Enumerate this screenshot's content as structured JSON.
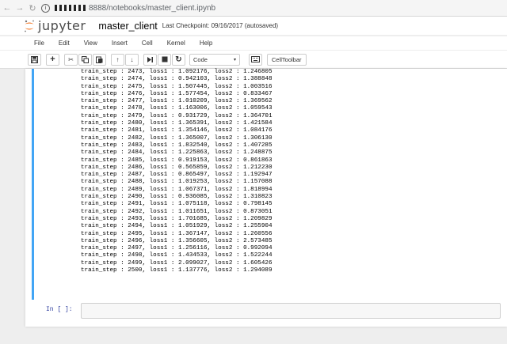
{
  "browser": {
    "url": "8888/notebooks/master_client.ipynb"
  },
  "header": {
    "logo_text": "jupyter",
    "notebook_name": "master_client",
    "checkpoint": "Last Checkpoint: 09/16/2017 (autosaved)"
  },
  "menu": [
    "File",
    "Edit",
    "View",
    "Insert",
    "Cell",
    "Kernel",
    "Help"
  ],
  "toolbar": {
    "cell_type": "Code",
    "celltoolbar_label": "CellToolbar"
  },
  "output_lines": [
    "train_step : 2473, loss1 : 1.092176, loss2 : 1.246805",
    "train_step : 2474, loss1 : 0.942103, loss2 : 1.388848",
    "train_step : 2475, loss1 : 1.507445, loss2 : 1.003516",
    "train_step : 2476, loss1 : 1.577454, loss2 : 0.833467",
    "train_step : 2477, loss1 : 1.010209, loss2 : 1.369562",
    "train_step : 2478, loss1 : 1.163006, loss2 : 1.059543",
    "train_step : 2479, loss1 : 0.931729, loss2 : 1.364701",
    "train_step : 2480, loss1 : 1.365391, loss2 : 1.421584",
    "train_step : 2481, loss1 : 1.354146, loss2 : 1.084176",
    "train_step : 2482, loss1 : 1.365007, loss2 : 1.306130",
    "train_step : 2483, loss1 : 1.832540, loss2 : 1.407285",
    "train_step : 2484, loss1 : 1.225863, loss2 : 1.248875",
    "train_step : 2485, loss1 : 0.919153, loss2 : 0.861863",
    "train_step : 2486, loss1 : 0.565859, loss2 : 1.212230",
    "train_step : 2487, loss1 : 0.865497, loss2 : 1.192947",
    "train_step : 2488, loss1 : 1.019253, loss2 : 1.157088",
    "train_step : 2489, loss1 : 1.067371, loss2 : 1.818994",
    "train_step : 2490, loss1 : 0.936085, loss2 : 1.310823",
    "train_step : 2491, loss1 : 1.075118, loss2 : 0.798145",
    "train_step : 2492, loss1 : 1.011651, loss2 : 0.873051",
    "train_step : 2493, loss1 : 1.701685, loss2 : 1.209829",
    "train_step : 2494, loss1 : 1.051929, loss2 : 1.255904",
    "train_step : 2495, loss1 : 1.367147, loss2 : 1.260556",
    "train_step : 2496, loss1 : 1.356605, loss2 : 2.573485",
    "train_step : 2497, loss1 : 1.256116, loss2 : 0.992094",
    "train_step : 2498, loss1 : 1.434533, loss2 : 1.522244",
    "train_step : 2499, loss1 : 2.099027, loss2 : 1.605426",
    "train_step : 2500, loss1 : 1.137776, loss2 : 1.294089"
  ],
  "input_prompt": "In [ ]:",
  "colors": {
    "selected_cell_border": "#42a5f5",
    "logo_orange": "#f37726"
  }
}
